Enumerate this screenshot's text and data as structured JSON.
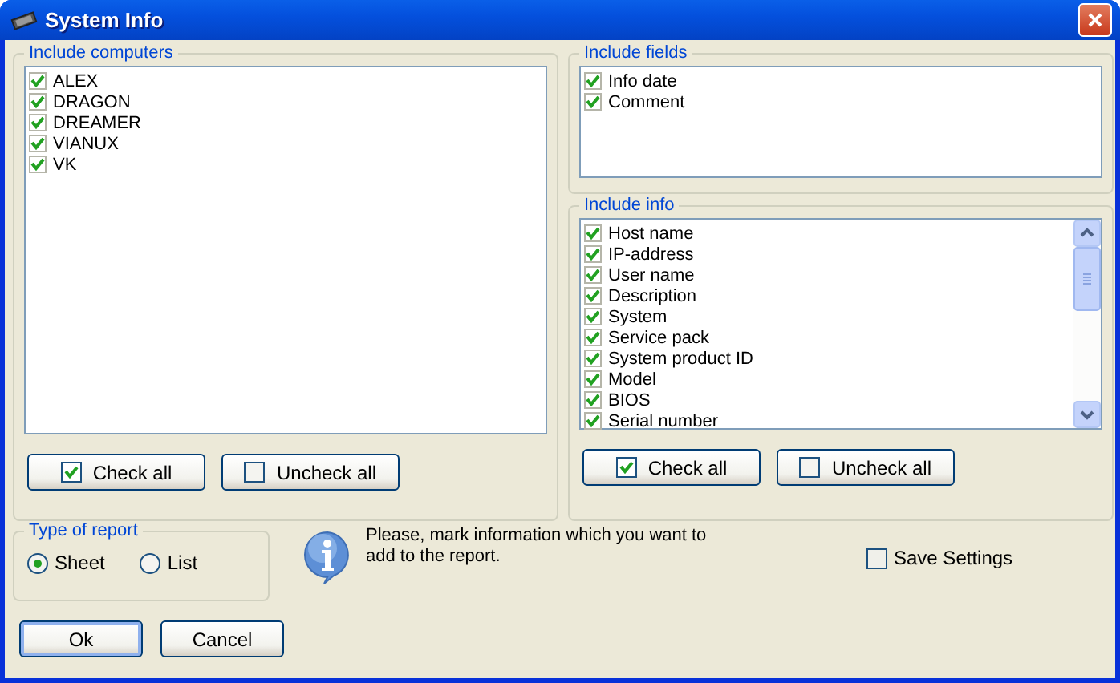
{
  "window": {
    "title": "System Info"
  },
  "computers": {
    "label": "Include computers",
    "items": [
      {
        "label": "ALEX",
        "checked": true
      },
      {
        "label": "DRAGON",
        "checked": true
      },
      {
        "label": "DREAMER",
        "checked": true
      },
      {
        "label": "VIANUX",
        "checked": true
      },
      {
        "label": "VK",
        "checked": true
      }
    ],
    "buttons": [
      {
        "label": "Check all",
        "kind": "check"
      },
      {
        "label": "Uncheck all",
        "kind": "uncheck"
      }
    ]
  },
  "fields": {
    "label": "Include fields",
    "items": [
      {
        "label": "Info date",
        "checked": true
      },
      {
        "label": "Comment",
        "checked": true
      }
    ]
  },
  "info": {
    "label": "Include info",
    "items": [
      {
        "label": "Host name",
        "checked": true
      },
      {
        "label": "IP-address",
        "checked": true
      },
      {
        "label": "User name",
        "checked": true
      },
      {
        "label": "Description",
        "checked": true
      },
      {
        "label": "System",
        "checked": true
      },
      {
        "label": "Service pack",
        "checked": true
      },
      {
        "label": "System product ID",
        "checked": true
      },
      {
        "label": "Model",
        "checked": true
      },
      {
        "label": "BIOS",
        "checked": true
      },
      {
        "label": "Serial number",
        "checked": true
      }
    ],
    "buttons": [
      {
        "label": "Check all",
        "kind": "check"
      },
      {
        "label": "Uncheck all",
        "kind": "uncheck"
      }
    ]
  },
  "report_type": {
    "label": "Type of report",
    "options": [
      {
        "label": "Sheet",
        "selected": true
      },
      {
        "label": "List",
        "selected": false
      }
    ]
  },
  "message": "Please, mark information which you want to add to the report.",
  "save_settings": {
    "label": "Save Settings",
    "checked": false
  },
  "buttons": [
    {
      "label": "Ok",
      "default": true
    },
    {
      "label": "Cancel",
      "default": false
    }
  ]
}
